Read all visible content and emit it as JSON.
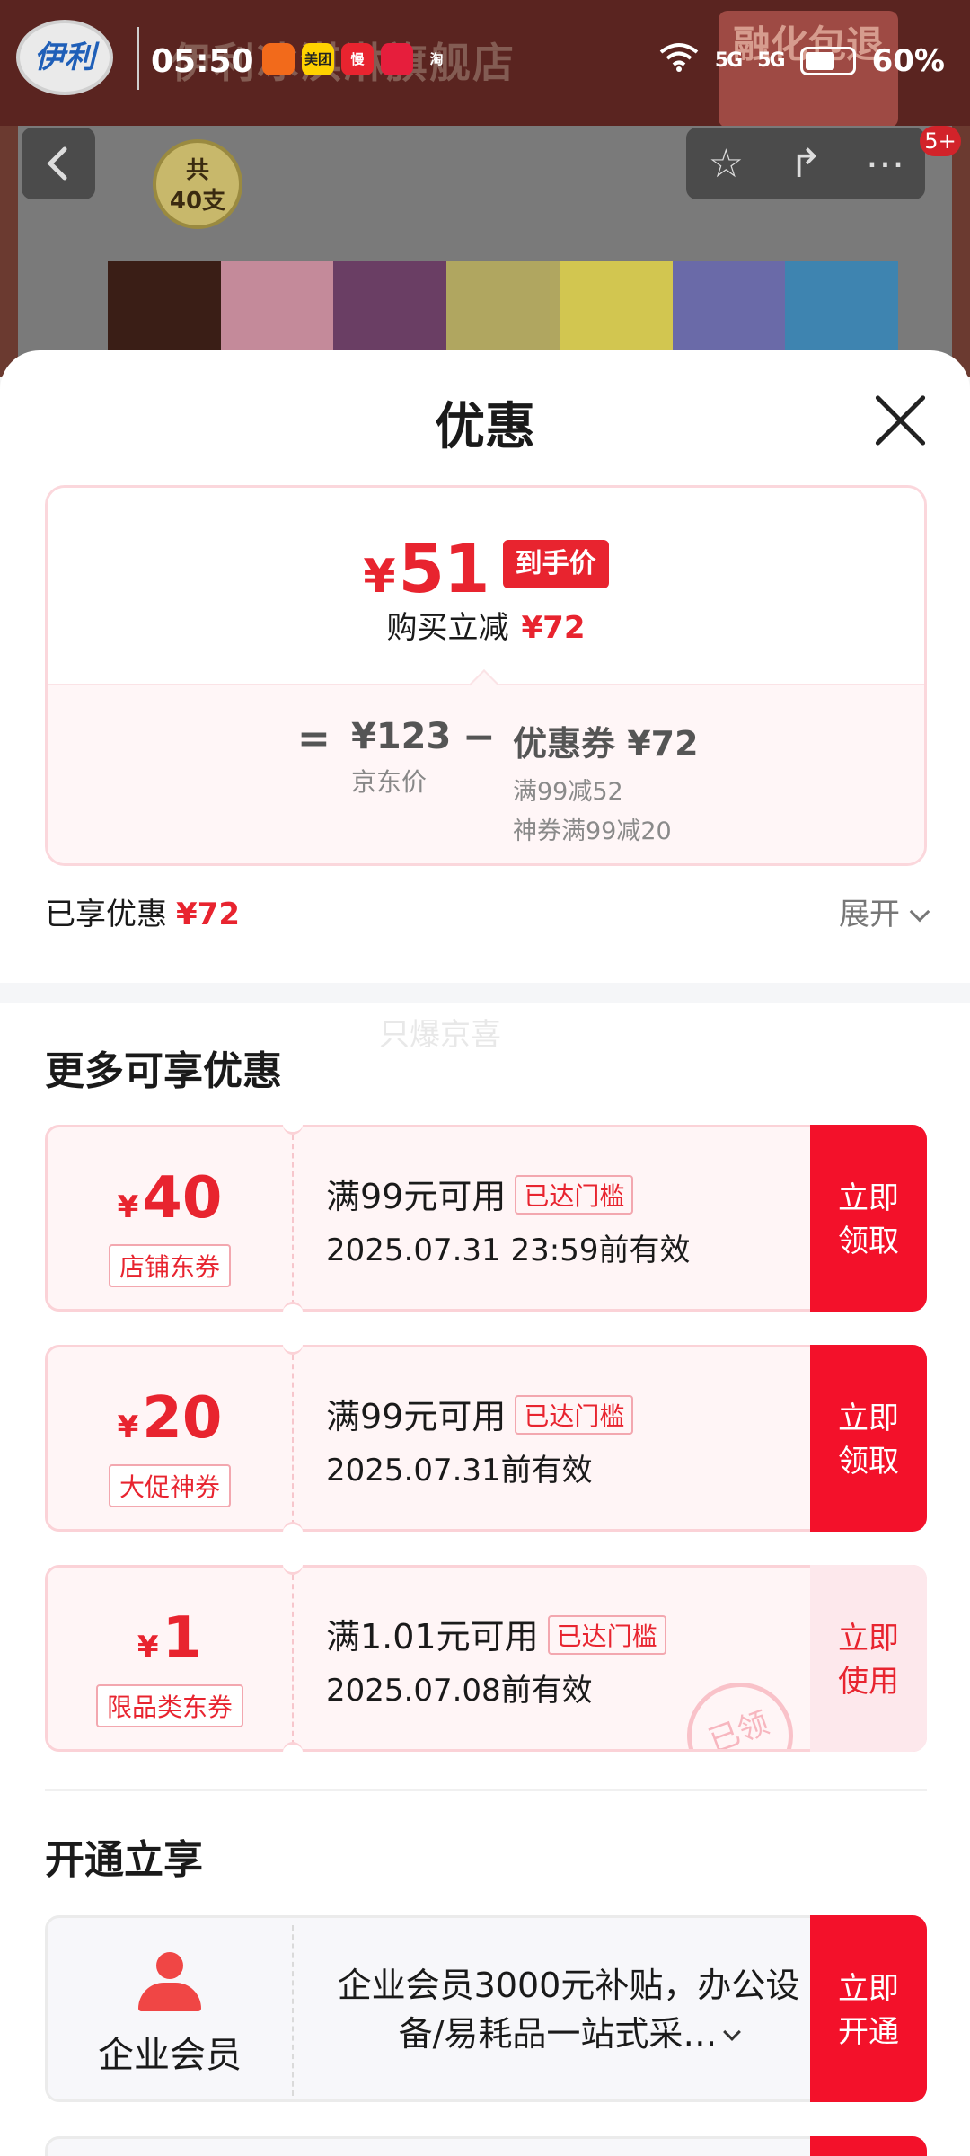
{
  "status_bar": {
    "time": "05:50",
    "apps": [
      "美团",
      "慢",
      "淘"
    ],
    "signal_1": "5G",
    "signal_2": "5G",
    "battery": "60%"
  },
  "background": {
    "shop_name": "伊利冰淇淋旗舰店",
    "brand_logo": "伊利",
    "promo_badge": "融化包退",
    "count_badge_line1": "共",
    "count_badge_line2": "40支",
    "notification_count": "5+"
  },
  "sheet": {
    "title": "优惠",
    "price_card": {
      "final_price_symbol": "¥",
      "final_price": "51",
      "final_tag": "到手价",
      "reduce_label": "购买立减",
      "reduce_value": "¥72",
      "equals": "=",
      "jd_price": "¥123",
      "jd_price_label": "京东价",
      "minus": "−",
      "coupon_label": "优惠券 ¥72",
      "coupon_detail_1": "满99减52",
      "coupon_detail_2": "神券满99减20"
    },
    "enjoyed": {
      "label": "已享优惠",
      "value": "¥72",
      "expand": "展开"
    },
    "watermark": "只爆京喜",
    "more_section_title": "更多可享优惠",
    "coupons": [
      {
        "symbol": "¥",
        "amount": "40",
        "type": "店铺东券",
        "condition": "满99元可用",
        "tag": "已达门槛",
        "validity": "2025.07.31 23:59前有效",
        "button_line1": "立即",
        "button_line2": "领取"
      },
      {
        "symbol": "¥",
        "amount": "20",
        "type": "大促神券",
        "condition": "满99元可用",
        "tag": "已达门槛",
        "validity": "2025.07.31前有效",
        "button_line1": "立即",
        "button_line2": "领取"
      },
      {
        "symbol": "¥",
        "amount": "1",
        "type": "限品类东券",
        "condition": "满1.01元可用",
        "tag": "已达门槛",
        "validity": "2025.07.08前有效",
        "button_line1": "立即",
        "button_line2": "使用",
        "stamp": "已领"
      }
    ],
    "membership_section_title": "开通立享",
    "membership": {
      "name": "企业会员",
      "description": "企业会员3000元补贴，办公设备/易耗品一站式采…",
      "button_line1": "立即",
      "button_line2": "开通"
    }
  },
  "colors": {
    "accent_red": "#e8242f",
    "button_red": "#f3112a",
    "coupon_bg": "#fff5f6"
  }
}
